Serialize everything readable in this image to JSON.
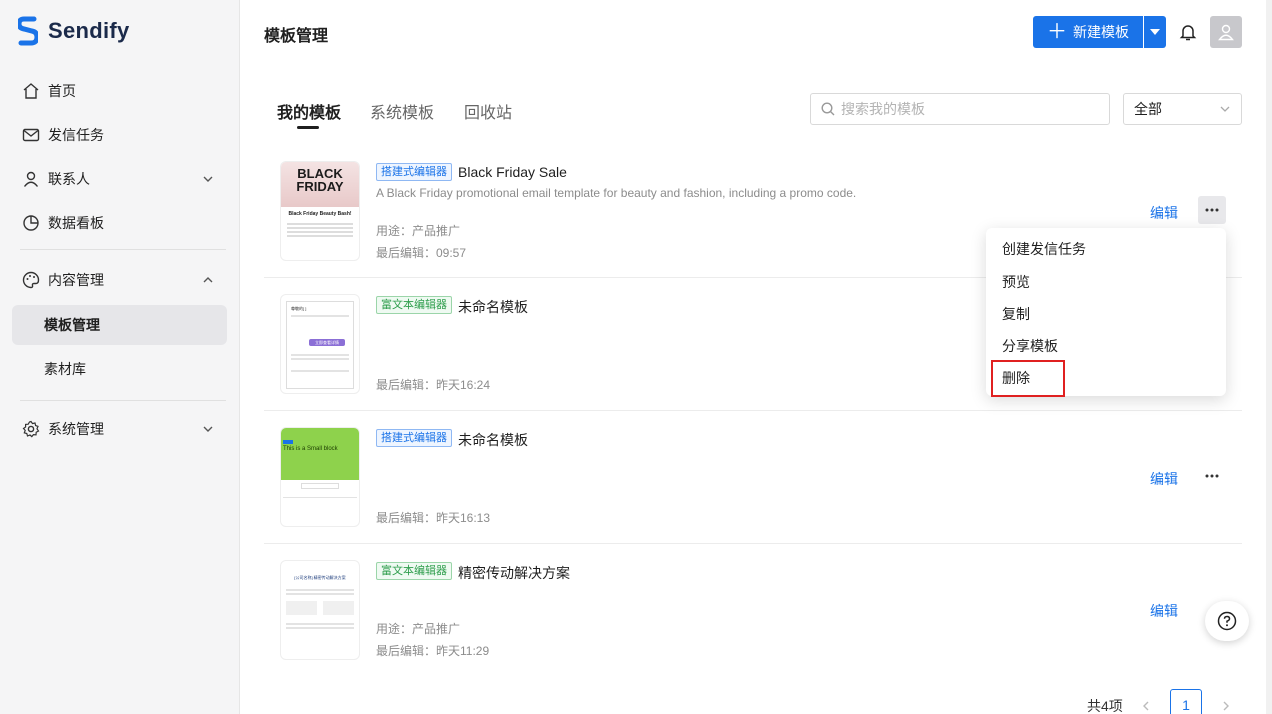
{
  "app": {
    "name": "Sendify"
  },
  "sidebar": {
    "items": [
      {
        "label": "首页",
        "icon": "home-icon"
      },
      {
        "label": "发信任务",
        "icon": "mail-icon"
      },
      {
        "label": "联系人",
        "icon": "user-icon",
        "expandable": true
      },
      {
        "label": "数据看板",
        "icon": "pie-chart-icon"
      },
      {
        "label": "内容管理",
        "icon": "palette-icon",
        "expanded": true
      },
      {
        "label": "模板管理",
        "sub": true,
        "active": true
      },
      {
        "label": "素材库",
        "sub": true
      },
      {
        "label": "系统管理",
        "icon": "gear-icon",
        "expandable": true
      }
    ]
  },
  "header": {
    "title": "模板管理",
    "new_button_label": "新建模板"
  },
  "tabs": [
    {
      "label": "我的模板",
      "active": true
    },
    {
      "label": "系统模板"
    },
    {
      "label": "回收站"
    }
  ],
  "search": {
    "placeholder": "搜索我的模板",
    "value": ""
  },
  "filter": {
    "value": "全部"
  },
  "templates": [
    {
      "editor": "搭建式编辑器",
      "name": "Black Friday Sale",
      "description": "A Black Friday promotional email template for beauty and fashion, including a promo code.",
      "usage": "用途：产品推广",
      "last_edit": "最后编辑：09:57",
      "edit_label": "编辑"
    },
    {
      "editor": "富文本编辑器",
      "name": "未命名模板",
      "last_edit": "最后编辑：昨天16:24"
    },
    {
      "editor": "搭建式编辑器",
      "name": "未命名模板",
      "last_edit": "最后编辑：昨天16:13",
      "edit_label": "编辑"
    },
    {
      "editor": "富文本编辑器",
      "name": "精密传动解决方案",
      "usage": "用途：产品推广",
      "last_edit": "最后编辑：昨天11:29",
      "edit_label": "编辑"
    }
  ],
  "thumb_text": {
    "bf_title": "BLACK",
    "bf_title2": "FRIDAY",
    "bf_sub": "Black Friday Beauty Bash!",
    "t2_head": "尊敬的[  ]",
    "t2_button": "立即查看详情",
    "t3_text": "This is a Small block",
    "t4_title": "[公司名称] 精密传动解决方案"
  },
  "context_menu": {
    "items": [
      "创建发信任务",
      "预览",
      "复制",
      "分享模板",
      "删除"
    ]
  },
  "pagination": {
    "total": "共4项",
    "current": "1"
  },
  "colors": {
    "primary": "#1a73e8",
    "highlight": "#e02020"
  }
}
